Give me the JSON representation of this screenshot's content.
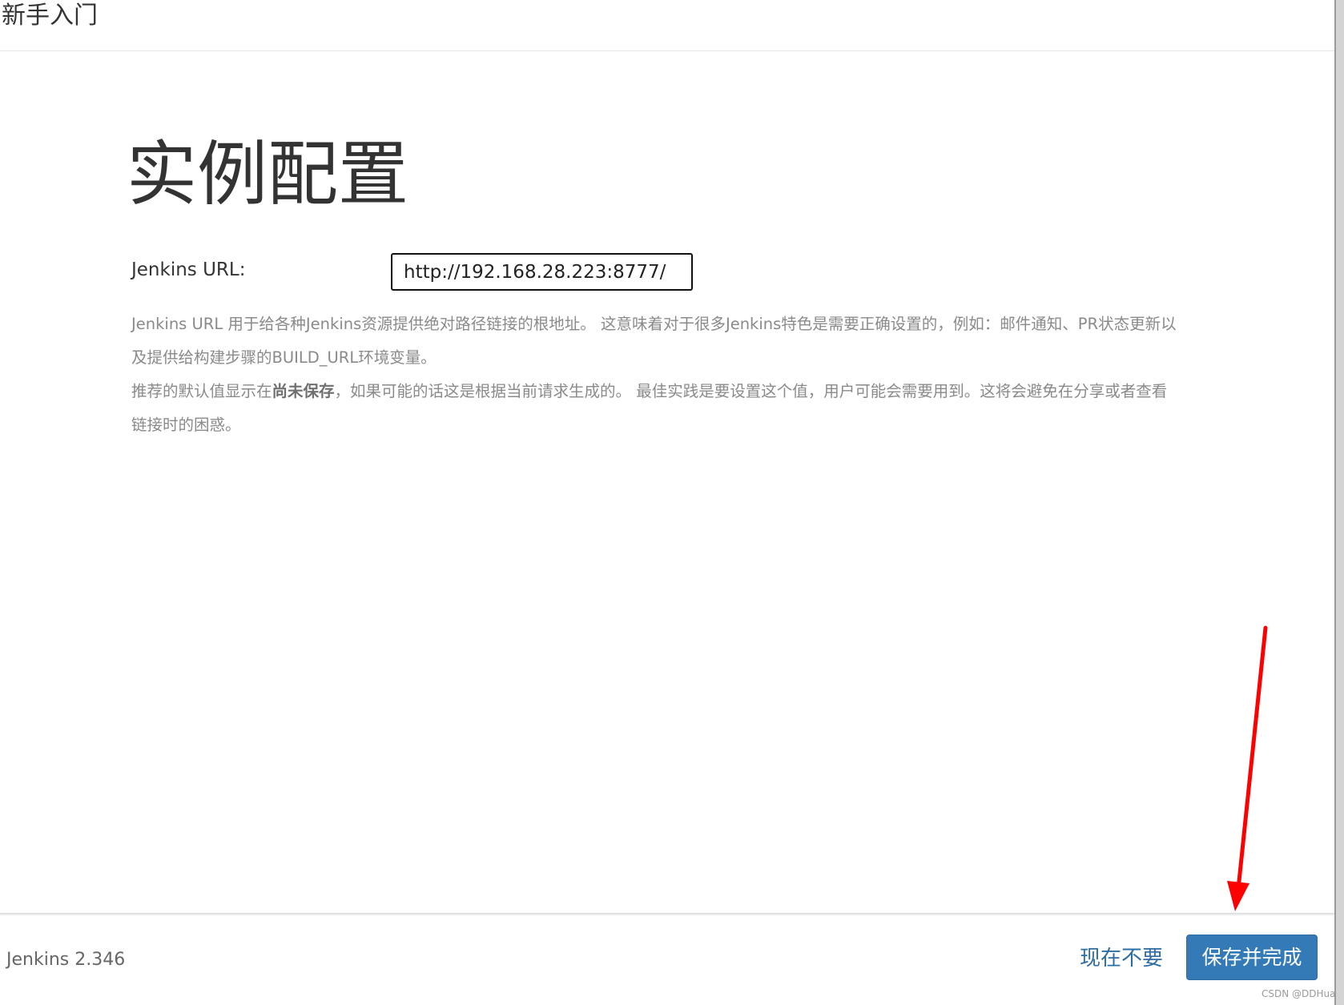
{
  "header": {
    "title": "新手入门"
  },
  "main": {
    "title": "实例配置",
    "url_label": "Jenkins URL:",
    "url_value": "http://192.168.28.223:8777/",
    "help_line1": "Jenkins URL 用于给各种Jenkins资源提供绝对路径链接的根地址。 这意味着对于很多Jenkins特色是需要正确设置的，例如：邮件通知、PR状态更新以及提供给构建步骤的BUILD_URL环境变量。",
    "help_line2_prefix": "推荐的默认值显示在",
    "help_line2_bold": "尚未保存",
    "help_line2_suffix": "，如果可能的话这是根据当前请求生成的。 最佳实践是要设置这个值，用户可能会需要用到。这将会避免在分享或者查看链接时的困惑。"
  },
  "footer": {
    "version": "Jenkins 2.346",
    "skip_label": "现在不要",
    "save_label": "保存并完成"
  },
  "annotation": {
    "arrow_color": "#ff0000"
  },
  "watermark": "CSDN @DDHuao",
  "colors": {
    "primary": "#337ab7",
    "link": "#2e6da4",
    "text": "#333333",
    "help_text": "#8a8a8a"
  }
}
